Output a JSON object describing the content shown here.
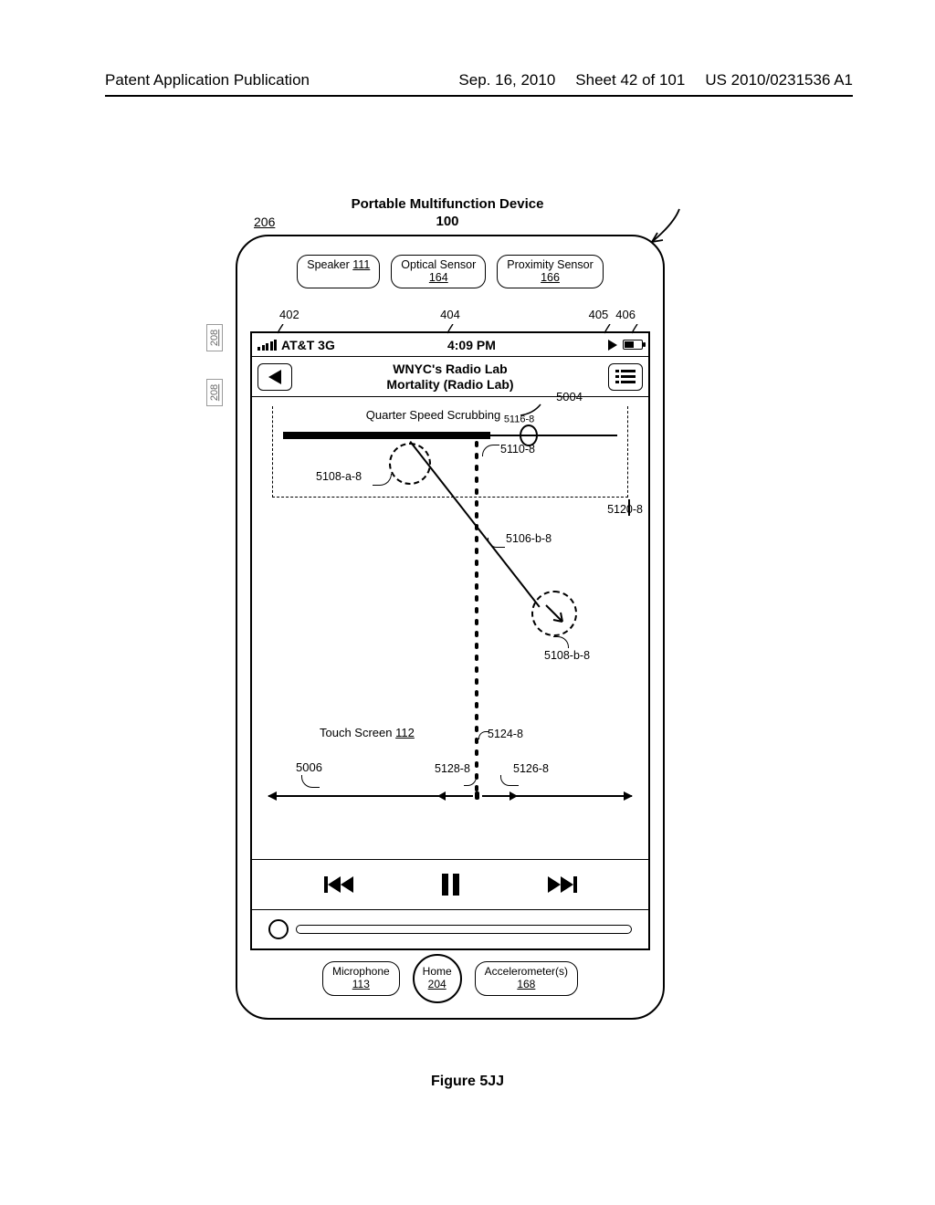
{
  "header": {
    "left": "Patent Application Publication",
    "date": "Sep. 16, 2010",
    "sheet": "Sheet 42 of 101",
    "docnum": "US 2010/0231536 A1"
  },
  "figure": {
    "title": "Portable Multifunction Device",
    "device_ref": "100",
    "ref_206": "206",
    "ref_208": "208",
    "caption": "Figure 5JJ"
  },
  "top_components": {
    "speaker": "Speaker",
    "speaker_ref": "111",
    "optical": "Optical Sensor",
    "optical_ref": "164",
    "proximity": "Proximity Sensor",
    "proximity_ref": "166"
  },
  "status_refs": {
    "r402": "402",
    "r404": "404",
    "r405": "405",
    "r406": "406"
  },
  "statusbar": {
    "carrier": "AT&T 3G",
    "time": "4:09 PM"
  },
  "nav": {
    "title1": "WNYC's Radio Lab",
    "title2": "Mortality (Radio Lab)"
  },
  "content": {
    "scrubbing_label": "Quarter Speed Scrubbing",
    "scrubbing_ref": "5116-8",
    "r5004": "5004",
    "r5108a": "5108-a-8",
    "r5110": "5110-8",
    "r5120": "5120-8",
    "r5106b": "5106-b-8",
    "r5108b": "5108-b-8",
    "touchscreen": "Touch Screen",
    "touchscreen_ref": "112",
    "r5124": "5124-8",
    "r5006": "5006",
    "r5128": "5128-8",
    "r5126": "5126-8"
  },
  "bottom_components": {
    "mic": "Microphone",
    "mic_ref": "113",
    "home": "Home",
    "home_ref": "204",
    "accel": "Accelerometer(s)",
    "accel_ref": "168"
  }
}
